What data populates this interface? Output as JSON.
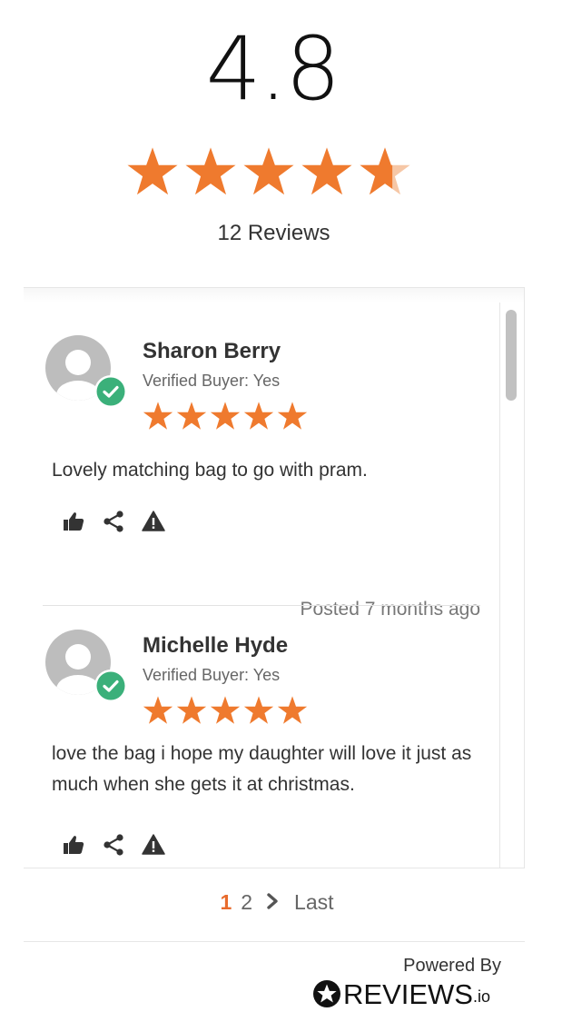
{
  "summary": {
    "rating": "4.8",
    "rating_fraction": 0.96,
    "review_count_label": "12 Reviews"
  },
  "colors": {
    "star": "#ef7a2e",
    "verified_badge": "#3bb07a",
    "active_page": "#e86b2d"
  },
  "reviews": [
    {
      "name": "Sharon Berry",
      "verified": "Verified Buyer: Yes",
      "stars": 5,
      "text": "Lovely matching bag to go with pram.",
      "posted": "Posted 7 months ago"
    },
    {
      "name": "Michelle Hyde",
      "verified": "Verified Buyer: Yes",
      "stars": 5,
      "text": "love the bag i hope my daughter will love it just as much when she gets it at christmas.",
      "posted": ""
    }
  ],
  "pagination": {
    "current": "1",
    "next": "2",
    "last": "Last"
  },
  "footer": {
    "powered_by": "Powered By",
    "brand": "REVIEWS",
    "brand_suffix": ".io"
  },
  "icons": {
    "like": "thumbs-up-icon",
    "share": "share-icon",
    "report": "warning-icon"
  }
}
